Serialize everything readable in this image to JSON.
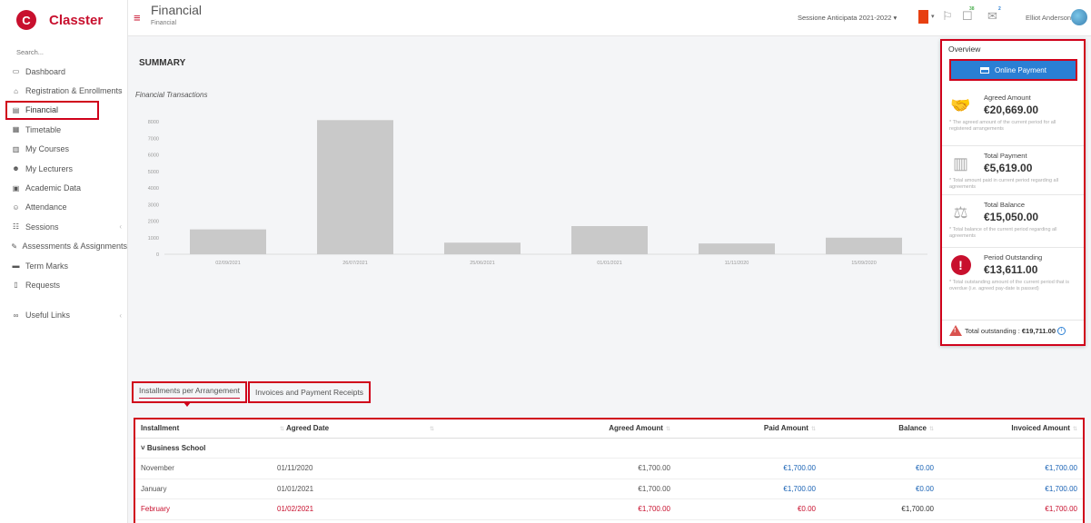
{
  "app": {
    "brand": "Classter",
    "logo_letter": "C"
  },
  "sidebar": {
    "search_placeholder": "Search...",
    "items": [
      {
        "label": "Dashboard",
        "icon": "laptop-icon",
        "glyph": "▭"
      },
      {
        "label": "Registration & Enrollments",
        "icon": "institution-icon",
        "glyph": "⌂",
        "chevron": "‹"
      },
      {
        "label": "Financial",
        "icon": "money-icon",
        "glyph": "▤",
        "active": true
      },
      {
        "label": "Timetable",
        "icon": "calendar-icon",
        "glyph": "▦"
      },
      {
        "label": "My Courses",
        "icon": "books-icon",
        "glyph": "▥"
      },
      {
        "label": "My Lecturers",
        "icon": "users-icon",
        "glyph": "☻"
      },
      {
        "label": "Academic Data",
        "icon": "id-card-icon",
        "glyph": "▣"
      },
      {
        "label": "Attendance",
        "icon": "user-check-icon",
        "glyph": "☺"
      },
      {
        "label": "Sessions",
        "icon": "group-icon",
        "glyph": "☷",
        "chevron": "‹"
      },
      {
        "label": "Assessments & Assignments",
        "icon": "edit-icon",
        "glyph": "✎"
      },
      {
        "label": "Term Marks",
        "icon": "ticket-icon",
        "glyph": "▬"
      },
      {
        "label": "Requests",
        "icon": "document-icon",
        "glyph": "▯"
      }
    ],
    "useful_links": {
      "label": "Useful Links",
      "icon": "link-icon",
      "glyph": "∞",
      "chevron": "‹"
    }
  },
  "header": {
    "title": "Financial",
    "breadcrumb": "Financial",
    "session": "Sessione Anticipata 2021-2022 ▾",
    "notification_count": "38",
    "message_count": "2",
    "user_name": "Elliot Anderson ▾"
  },
  "summary": {
    "title": "SUMMARY"
  },
  "chart_data": {
    "type": "bar",
    "title": "Financial Transactions",
    "categories": [
      "02/09/2021",
      "26/07/2021",
      "25/06/2021",
      "01/01/2021",
      "11/11/2020",
      "15/09/2020"
    ],
    "values": [
      1500,
      8100,
      700,
      1700,
      650,
      1000
    ],
    "yticks": [
      0,
      1000,
      2000,
      3000,
      4000,
      5000,
      6000,
      7000,
      8000
    ],
    "ylim": [
      0,
      8500
    ],
    "bar_color": "#c9c9c9",
    "grid": false
  },
  "tabs": [
    {
      "label": "Installments per Arrangement",
      "active": true
    },
    {
      "label": "Invoices and Payment Receipts",
      "active": false
    }
  ],
  "table": {
    "headers": [
      "Installment",
      "Agreed Date",
      "",
      "Agreed Amount",
      "Paid Amount",
      "Balance",
      "Invoiced Amount"
    ],
    "group": "Business School",
    "group_caret": "˅",
    "rows": [
      {
        "installment": "November",
        "date": "01/11/2020",
        "agreed": "€1,700.00",
        "paid": "€1,700.00",
        "balance": "€0.00",
        "invoiced": "€1,700.00",
        "overdue": false
      },
      {
        "installment": "January",
        "date": "01/01/2021",
        "agreed": "€1,700.00",
        "paid": "€1,700.00",
        "balance": "€0.00",
        "invoiced": "€1,700.00",
        "overdue": false
      },
      {
        "installment": "February",
        "date": "01/02/2021",
        "agreed": "€1,700.00",
        "paid": "€0.00",
        "balance": "€1,700.00",
        "invoiced": "€1,700.00",
        "overdue": true
      }
    ]
  },
  "overview": {
    "title": "Overview",
    "online_payment_label": "Online Payment",
    "stats": [
      {
        "label": "Agreed Amount",
        "value": "€20,669.00",
        "note": "* The agreed amount of the current period for all registered arrangements",
        "icon": "handshake-icon"
      },
      {
        "label": "Total Payment",
        "value": "€5,619.00",
        "note": "* Total amount paid in current period regarding all agreements",
        "icon": "bar-chart-icon"
      },
      {
        "label": "Total Balance",
        "value": "€15,050.00",
        "note": "* Total balance of the current period regarding all agreements",
        "icon": "scale-icon"
      },
      {
        "label": "Period Outstanding",
        "value": "€13,611.00",
        "note": "* Total outstanding amount of the current period that is overdue (i.e. agreed pay-date is passed)",
        "icon": "exclamation-icon"
      }
    ],
    "total_outstanding_label": "Total outstanding :",
    "total_outstanding_value": "€19,711.00"
  }
}
